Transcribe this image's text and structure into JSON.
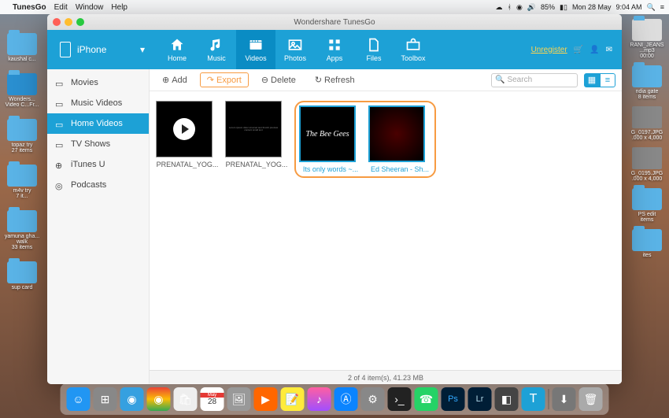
{
  "menubar": {
    "appname": "TunesGo",
    "menus": [
      "Edit",
      "Window",
      "Help"
    ],
    "battery": "85%",
    "date": "Mon 28 May",
    "time": "9:04 AM"
  },
  "window": {
    "title": "Wondershare TunesGo"
  },
  "toolbar": {
    "device": "iPhone",
    "tabs": [
      {
        "label": "Home",
        "icon": "home-icon"
      },
      {
        "label": "Music",
        "icon": "music-icon"
      },
      {
        "label": "Videos",
        "icon": "videos-icon"
      },
      {
        "label": "Photos",
        "icon": "photos-icon"
      },
      {
        "label": "Apps",
        "icon": "apps-icon"
      },
      {
        "label": "Files",
        "icon": "files-icon"
      },
      {
        "label": "Toolbox",
        "icon": "toolbox-icon"
      }
    ],
    "active_tab": "Videos",
    "unregister": "Unregister"
  },
  "sidebar": {
    "items": [
      {
        "label": "Movies"
      },
      {
        "label": "Music Videos"
      },
      {
        "label": "Home Videos"
      },
      {
        "label": "TV Shows"
      },
      {
        "label": "iTunes U"
      },
      {
        "label": "Podcasts"
      }
    ],
    "active": "Home Videos"
  },
  "actions": {
    "add": "Add",
    "export": "Export",
    "delete": "Delete",
    "refresh": "Refresh",
    "search_placeholder": "Search"
  },
  "videos": [
    {
      "label": "PRENATAL_YOG...",
      "selected": false,
      "thumb": "play"
    },
    {
      "label": "PRENATAL_YOG...",
      "selected": false,
      "thumb": "text"
    },
    {
      "label": "Its only words ~...",
      "selected": true,
      "thumb": "beegees"
    },
    {
      "label": "Ed Sheeran - Sh...",
      "selected": true,
      "thumb": "red"
    }
  ],
  "statusbar": {
    "text": "2 of 4 item(s), 41.23 MB"
  },
  "desktop_left": [
    {
      "label": "kaushal c...",
      "sub": ""
    },
    {
      "label": "Wonders...",
      "sub": "Video C...Fr..."
    },
    {
      "label": "topaz try",
      "sub": "27 items"
    },
    {
      "label": "m4v try",
      "sub": "7 it..."
    },
    {
      "label": "yamuna gha... walk",
      "sub": "33 items"
    },
    {
      "label": "sup card",
      "sub": ""
    }
  ],
  "desktop_right": [
    {
      "label": "RANI_JEANS ...mp3",
      "sub": "00:00",
      "type": "file"
    },
    {
      "label": "ndia gate",
      "sub": "8 items",
      "type": "folder"
    },
    {
      "label": "G_0197.JPG",
      "sub": ".000 x 4,000",
      "type": "img"
    },
    {
      "label": "G_0195.JPG",
      "sub": ".000 x 4,000",
      "type": "img"
    },
    {
      "label": "PS edit",
      "sub": " items",
      "type": "folder"
    },
    {
      "label": "",
      "sub": "ites",
      "type": "folder"
    }
  ]
}
